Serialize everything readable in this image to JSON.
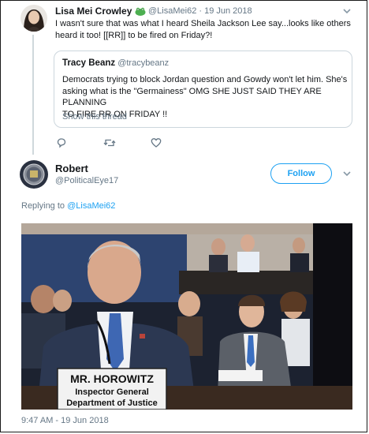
{
  "tweet1": {
    "display_name": "Lisa Mei Crowley",
    "handle_date": "@LisaMei62 · 19 Jun 2018",
    "text_line1": "I wasn't sure that was what I heard Sheila Jackson Lee say...looks like others",
    "text_line2": "heard it too! [[RR]] to be fired on Friday?!"
  },
  "quoted": {
    "display_name": "Tracy Beanz",
    "handle": "@tracybeanz",
    "line1": "Democrats trying to block Jordan question and Gowdy won't let him. She's",
    "line2": "asking what is the \"Germainess\" OMG SHE JUST SAID THEY ARE PLANNING",
    "line3": "TO FIRE RR ON FRIDAY !!",
    "show_thread": "Show this thread"
  },
  "tweet2": {
    "display_name": "Robert",
    "handle": "@PoliticalEye17",
    "follow_label": "Follow",
    "replying_to_prefix": "Replying to ",
    "replying_to_handle": "@LisaMei62",
    "placard_line1": "MR. HOROWITZ",
    "placard_line2": "Inspector General",
    "placard_line3": "Department of Justice",
    "timestamp": "9:47 AM - 19 Jun 2018"
  },
  "colors": {
    "accent": "#1da1f2",
    "muted": "#657786",
    "emoji_green": "#4caf50"
  },
  "icons": [
    "reply-icon",
    "retweet-icon",
    "like-icon",
    "chevron-down-icon",
    "frog-emoji-icon"
  ]
}
